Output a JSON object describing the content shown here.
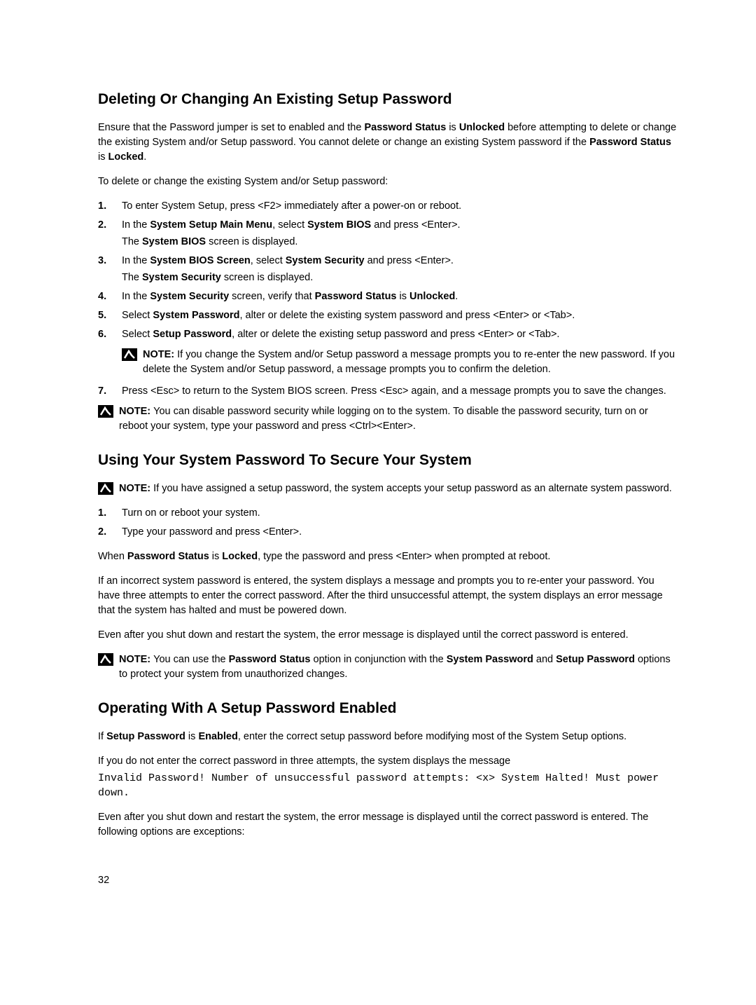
{
  "section1": {
    "heading": "Deleting Or Changing An Existing Setup Password",
    "intro_pre": "Ensure that the Password jumper is set to enabled and the ",
    "intro_b1": "Password Status",
    "intro_mid1": " is ",
    "intro_b2": "Unlocked",
    "intro_mid2": " before attempting to delete or change the existing System and/or Setup password. You cannot delete or change an existing System password if the ",
    "intro_b3": "Password Status",
    "intro_mid3": " is ",
    "intro_b4": "Locked",
    "intro_end": ".",
    "lead": "To delete or change the existing System and/or Setup password:",
    "li1": "To enter System Setup, press <F2> immediately after a power-on or reboot.",
    "li2_pre": "In the ",
    "li2_b1": "System Setup Main Menu",
    "li2_mid": ", select ",
    "li2_b2": "System BIOS",
    "li2_end": " and press <Enter>.",
    "li2_sub_pre": "The ",
    "li2_sub_b": "System BIOS",
    "li2_sub_end": " screen is displayed.",
    "li3_pre": "In the ",
    "li3_b1": "System BIOS Screen",
    "li3_mid": ", select ",
    "li3_b2": "System Security",
    "li3_end": " and press <Enter>.",
    "li3_sub_pre": "The ",
    "li3_sub_b": "System Security",
    "li3_sub_end": " screen is displayed.",
    "li4_pre": "In the ",
    "li4_b1": "System Security",
    "li4_mid1": " screen, verify that ",
    "li4_b2": "Password Status",
    "li4_mid2": " is ",
    "li4_b3": "Unlocked",
    "li4_end": ".",
    "li5_pre": "Select ",
    "li5_b": "System Password",
    "li5_end": ", alter or delete the existing system password and press <Enter> or <Tab>.",
    "li6_pre": "Select ",
    "li6_b": "Setup Password",
    "li6_end": ", alter or delete the existing setup password and press <Enter> or <Tab>.",
    "li6_note_label": "NOTE: ",
    "li6_note_text": "If you change the System and/or Setup password a message prompts you to re-enter the new password. If you delete the System and/or Setup password, a message prompts you to confirm the deletion.",
    "li7": "Press <Esc> to return to the System BIOS screen. Press <Esc> again, and a message prompts you to save the changes.",
    "note_after_label": "NOTE: ",
    "note_after_text": "You can disable password security while logging on to the system. To disable the password security, turn on or reboot your system, type your password and press <Ctrl><Enter>."
  },
  "section2": {
    "heading": "Using Your System Password To Secure Your System",
    "note1_label": "NOTE: ",
    "note1_text": "If you have assigned a setup password, the system accepts your setup password as an alternate system password.",
    "li1": "Turn on or reboot your system.",
    "li2": "Type your password and press <Enter>.",
    "p1_pre": "When ",
    "p1_b1": "Password Status",
    "p1_mid": " is ",
    "p1_b2": "Locked",
    "p1_end": ", type the password and press <Enter> when prompted at reboot.",
    "p2": "If an incorrect system password is entered, the system displays a message and prompts you to re-enter your password. You have three attempts to enter the correct password. After the third unsuccessful attempt, the system displays an error message that the system has halted and must be powered down.",
    "p3": "Even after you shut down and restart the system, the error message is displayed until the correct password is entered.",
    "note2_label": "NOTE: ",
    "note2_pre": "You can use the ",
    "note2_b1": "Password Status",
    "note2_mid1": " option in conjunction with the ",
    "note2_b2": "System Password",
    "note2_mid2": " and ",
    "note2_b3": "Setup Password",
    "note2_end": " options to protect your system from unauthorized changes."
  },
  "section3": {
    "heading": "Operating With A Setup Password Enabled",
    "p1_pre": "If ",
    "p1_b1": "Setup Password",
    "p1_mid": " is ",
    "p1_b2": "Enabled",
    "p1_end": ", enter the correct setup password before modifying most of the System Setup options.",
    "p2": "If you do not enter the correct password in three attempts, the system displays the message",
    "cmd": "Invalid Password! Number of unsuccessful password attempts: <x> System Halted! Must power down.",
    "p3": "Even after you shut down and restart the system, the error message is displayed until the correct password is entered. The following options are exceptions:"
  },
  "pagenum": "32"
}
